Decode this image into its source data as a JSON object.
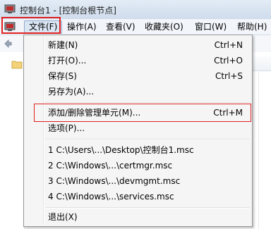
{
  "window": {
    "title": "控制台1 - [控制台根节点]"
  },
  "menubar": {
    "items": [
      {
        "label": "文件(F)"
      },
      {
        "label": "操作(A)"
      },
      {
        "label": "查看(V)"
      },
      {
        "label": "收藏夹(O)"
      },
      {
        "label": "窗口(W)"
      },
      {
        "label": "帮助(H)"
      }
    ]
  },
  "file_menu": {
    "items": [
      {
        "label": "新建(N)",
        "shortcut": "Ctrl+N"
      },
      {
        "label": "打开(O)...",
        "shortcut": "Ctrl+O"
      },
      {
        "label": "保存(S)",
        "shortcut": "Ctrl+S"
      },
      {
        "label": "另存为(A)...",
        "shortcut": ""
      },
      {
        "label": "添加/删除管理单元(M)...",
        "shortcut": "Ctrl+M"
      },
      {
        "label": "选项(P)...",
        "shortcut": ""
      },
      {
        "label": "1 C:\\Users\\...\\Desktop\\控制台1.msc",
        "shortcut": ""
      },
      {
        "label": "2 C:\\Windows\\...\\certmgr.msc",
        "shortcut": ""
      },
      {
        "label": "3 C:\\Windows\\...\\devmgmt.msc",
        "shortcut": ""
      },
      {
        "label": "4 C:\\Windows\\...\\services.msc",
        "shortcut": ""
      },
      {
        "label": "退出(X)",
        "shortcut": ""
      }
    ]
  },
  "colors": {
    "highlight_box": "#e02020",
    "menu_bg": "#f5f5f5",
    "title_bg": "#dce7f4"
  },
  "icons": [
    "mmc-console-icon",
    "back-arrow-icon",
    "folder-icon"
  ]
}
